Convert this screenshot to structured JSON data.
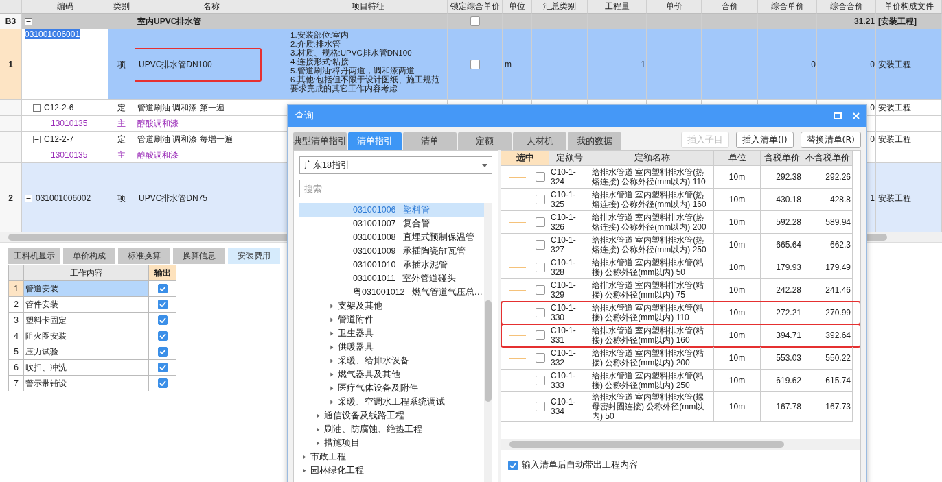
{
  "main_table": {
    "columns": [
      "编码",
      "类别",
      "名称",
      "项目特征",
      "锁定综合单价",
      "单位",
      "汇总类别",
      "工程量",
      "单价",
      "合价",
      "综合单价",
      "综合合价",
      "单价构成文件"
    ],
    "rows": [
      {
        "kind": "group",
        "row_no": "B3",
        "expanded": true,
        "name": "室内UPVC排水管",
        "lock_checked": false,
        "total_price": "31.21",
        "file": "[安装工程]",
        "selected": false,
        "children": [
          {
            "kind": "item",
            "row_no": "1",
            "code": "031001006001",
            "category": "项",
            "name": "UPVC排水管DN100",
            "marked": true,
            "features": "1.安装部位:室内\n2.介质:排水管\n3.材质、规格:UPVC排水管DN100\n4.连接形式:粘接\n5.管道刷油:樟丹两道，调和漆两道\n6.其他:包括但不限于设计图纸、施工规范要求完成的其它工作内容考虑",
            "lock_checked": false,
            "unit": "m",
            "quantity": "1",
            "unit_total": "0",
            "total_price": "0",
            "file": "安装工程",
            "selected": true,
            "children": [
              {
                "kind": "quota",
                "code": "C12-2-6",
                "expanded": true,
                "category": "定",
                "name": "管道刷油 调和漆 第一遍",
                "total_price": "0",
                "file": "安装工程",
                "selected": false,
                "children": [
                  {
                    "kind": "material",
                    "code": "13010135",
                    "category": "主",
                    "name": "醇酸调和漆",
                    "selected": false
                  }
                ]
              },
              {
                "kind": "quota",
                "code": "C12-2-7",
                "expanded": true,
                "category": "定",
                "name": "管道刷油 调和漆 每增一遍",
                "total_price": "0",
                "file": "安装工程",
                "selected": false,
                "children": [
                  {
                    "kind": "material",
                    "code": "13010135",
                    "category": "主",
                    "name": "醇酸调和漆",
                    "selected": false
                  }
                ]
              }
            ]
          },
          {
            "kind": "item",
            "row_no": "2",
            "code": "031001006002",
            "expanded": true,
            "category": "项",
            "name": "UPVC排水管DN75",
            "total_price": "1",
            "file": "安装工程",
            "selected": false
          }
        ]
      }
    ]
  },
  "bottom_tabs": [
    {
      "label": "工料机显示",
      "selected": false
    },
    {
      "label": "单价构成",
      "selected": false
    },
    {
      "label": "标准换算",
      "selected": false
    },
    {
      "label": "换算信息",
      "selected": false
    },
    {
      "label": "安装费用",
      "selected": true
    }
  ],
  "work_table": {
    "columns": [
      "工作内容",
      "输出"
    ],
    "rows": [
      {
        "row_no": "1",
        "content": "管道安装",
        "output": true,
        "selected": true
      },
      {
        "row_no": "2",
        "content": "管件安装",
        "output": true,
        "selected": false
      },
      {
        "row_no": "3",
        "content": "塑料卡固定",
        "output": true,
        "selected": false
      },
      {
        "row_no": "4",
        "content": "阻火圈安装",
        "output": true,
        "selected": false
      },
      {
        "row_no": "5",
        "content": "压力试验",
        "output": true,
        "selected": false
      },
      {
        "row_no": "6",
        "content": "吹扫、冲洗",
        "output": true,
        "selected": false
      },
      {
        "row_no": "7",
        "content": "警示带铺设",
        "output": true,
        "selected": false
      }
    ]
  },
  "dialog": {
    "title": "查询",
    "tabs": [
      {
        "label": "典型清单指引",
        "selected": false
      },
      {
        "label": "清单指引",
        "selected": true
      },
      {
        "label": "清单",
        "selected": false
      },
      {
        "label": "定额",
        "selected": false
      },
      {
        "label": "人材机",
        "selected": false
      },
      {
        "label": "我的数据",
        "selected": false
      }
    ],
    "buttons": [
      {
        "label": "插入子目",
        "disabled": true
      },
      {
        "label": "插入清单(I)",
        "disabled": false
      },
      {
        "label": "替换清单(R)",
        "disabled": false
      }
    ],
    "guide_select": {
      "value": "广东18指引"
    },
    "search": {
      "placeholder": "搜索"
    },
    "tree": [
      {
        "children": [
          {
            "children": [
              {
                "children": [
                  {
                    "code": "031001006",
                    "name": "塑料管",
                    "selected": true
                  },
                  {
                    "code": "031001007",
                    "name": "复合管",
                    "selected": false
                  },
                  {
                    "code": "031001008",
                    "name": "直埋式预制保温管",
                    "selected": false
                  },
                  {
                    "code": "031001009",
                    "name": "承插陶瓷缸瓦管",
                    "selected": false
                  },
                  {
                    "code": "031001010",
                    "name": "承插水泥管",
                    "selected": false
                  },
                  {
                    "code": "031001011",
                    "name": "室外管道碰头",
                    "selected": false
                  },
                  {
                    "code": "粤031001012",
                    "name": "燃气管道气压总…",
                    "selected": false
                  }
                ]
              },
              {
                "name": "支架及其他",
                "expanded": false,
                "selected": false
              },
              {
                "name": "管道附件",
                "expanded": false,
                "selected": false
              },
              {
                "name": "卫生器具",
                "expanded": false,
                "selected": false
              },
              {
                "name": "供暖器具",
                "expanded": false,
                "selected": false
              },
              {
                "name": "采暖、给排水设备",
                "expanded": false,
                "selected": false
              },
              {
                "name": "燃气器具及其他",
                "expanded": false,
                "selected": false
              },
              {
                "name": "医疗气体设备及附件",
                "expanded": false,
                "selected": false
              },
              {
                "name": "采暖、空调水工程系统调试",
                "expanded": false,
                "selected": false
              }
            ]
          },
          {
            "name": "通信设备及线路工程",
            "expanded": false,
            "selected": false
          },
          {
            "name": "刷油、防腐蚀、绝热工程",
            "expanded": false,
            "selected": false
          },
          {
            "name": "措施项目",
            "expanded": false,
            "selected": false
          }
        ]
      },
      {
        "name": "市政工程",
        "expanded": false,
        "selected": false
      },
      {
        "name": "园林绿化工程",
        "expanded": false,
        "selected": false
      }
    ],
    "quota_table": {
      "columns": [
        "选中",
        "定额号",
        "定额名称",
        "单位",
        "含税单价",
        "不含税单价"
      ],
      "rows": [
        {
          "code": "C10-1-324",
          "name": "给排水管道 室内塑料排水管(热熔连接) 公称外径(mm以内) 110",
          "unit": "10m",
          "price_tax": "292.38",
          "price_notax": "292.26",
          "checked": false,
          "marked": false
        },
        {
          "code": "C10-1-325",
          "name": "给排水管道 室内塑料排水管(热熔连接) 公称外径(mm以内) 160",
          "unit": "10m",
          "price_tax": "430.18",
          "price_notax": "428.8",
          "checked": false,
          "marked": false
        },
        {
          "code": "C10-1-326",
          "name": "给排水管道 室内塑料排水管(热熔连接) 公称外径(mm以内) 200",
          "unit": "10m",
          "price_tax": "592.28",
          "price_notax": "589.94",
          "checked": false,
          "marked": false
        },
        {
          "code": "C10-1-327",
          "name": "给排水管道 室内塑料排水管(热熔连接) 公称外径(mm以内) 250",
          "unit": "10m",
          "price_tax": "665.64",
          "price_notax": "662.3",
          "checked": false,
          "marked": false
        },
        {
          "code": "C10-1-328",
          "name": "给排水管道 室内塑料排水管(粘接) 公称外径(mm以内) 50",
          "unit": "10m",
          "price_tax": "179.93",
          "price_notax": "179.49",
          "checked": false,
          "marked": false
        },
        {
          "code": "C10-1-329",
          "name": "给排水管道 室内塑料排水管(粘接) 公称外径(mm以内) 75",
          "unit": "10m",
          "price_tax": "242.28",
          "price_notax": "241.46",
          "checked": false,
          "marked": false
        },
        {
          "code": "C10-1-330",
          "name": "给排水管道 室内塑料排水管(粘接) 公称外径(mm以内) 110",
          "unit": "10m",
          "price_tax": "272.21",
          "price_notax": "270.99",
          "checked": false,
          "marked": true
        },
        {
          "code": "C10-1-331",
          "name": "给排水管道 室内塑料排水管(粘接) 公称外径(mm以内) 160",
          "unit": "10m",
          "price_tax": "394.71",
          "price_notax": "392.64",
          "checked": false,
          "marked": true
        },
        {
          "code": "C10-1-332",
          "name": "给排水管道 室内塑料排水管(粘接) 公称外径(mm以内) 200",
          "unit": "10m",
          "price_tax": "553.03",
          "price_notax": "550.22",
          "checked": false,
          "marked": false
        },
        {
          "code": "C10-1-333",
          "name": "给排水管道 室内塑料排水管(粘接) 公称外径(mm以内) 250",
          "unit": "10m",
          "price_tax": "619.62",
          "price_notax": "615.74",
          "checked": false,
          "marked": false
        },
        {
          "code": "C10-1-334",
          "name": "给排水管道 室内塑料排水管(螺母密封圈连接) 公称外径(mm以内) 50",
          "unit": "10m",
          "price_tax": "167.78",
          "price_notax": "167.73",
          "checked": false,
          "marked": false
        }
      ]
    },
    "auto_fill": {
      "label": "输入清单后自动带出工程内容",
      "checked": true
    }
  }
}
